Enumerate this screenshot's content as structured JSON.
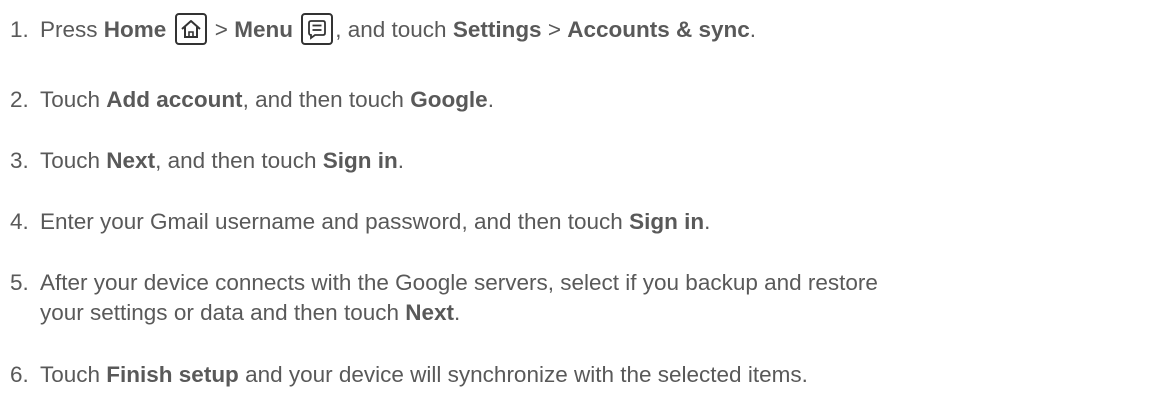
{
  "steps": [
    {
      "number": "1.",
      "press": "Press ",
      "home": "Home",
      "sep1": " > ",
      "menu": "Menu",
      "and_touch": ", and touch ",
      "settings": "Settings",
      "sep2": " > ",
      "accounts_sync": "Accounts & sync",
      "end": "."
    },
    {
      "number": "2.",
      "touch": "Touch ",
      "add_account": "Add account",
      "and_then": ", and then touch ",
      "google": "Google",
      "end": "."
    },
    {
      "number": "3.",
      "touch": "Touch ",
      "next": "Next",
      "and_then": ", and then touch ",
      "sign_in": "Sign in",
      "end": "."
    },
    {
      "number": "4.",
      "enter": "Enter your Gmail username and password, and then touch ",
      "sign_in": "Sign in",
      "end": "."
    },
    {
      "number": "5.",
      "line1": "After your device connects with the Google servers, select if you backup and restore",
      "line2": "your settings or data and then touch ",
      "next": "Next",
      "end": "."
    },
    {
      "number": "6.",
      "touch": "Touch ",
      "finish_setup": "Finish setup",
      "rest": " and your device will synchronize with the selected items."
    }
  ],
  "icons": {
    "home": "home-icon",
    "menu": "menu-icon"
  }
}
